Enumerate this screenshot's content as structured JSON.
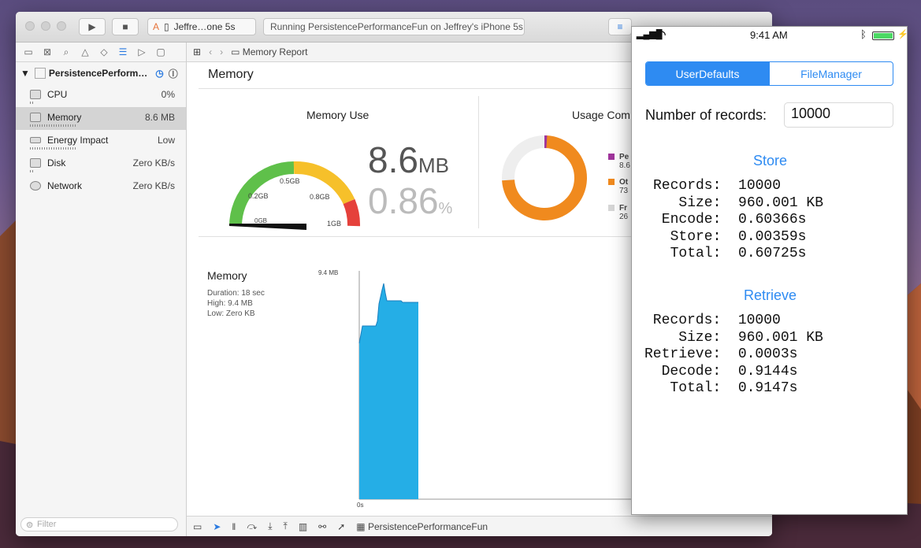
{
  "desktop": {
    "description": "macOS Sierra wallpaper"
  },
  "xcode": {
    "toolbar": {
      "scheme_target": "Jeffre…one 5s",
      "activity_status": "Running PersistencePerformanceFun on Jeffrey's iPhone 5s"
    },
    "navigator": {
      "project_name": "PersistencePerform…",
      "gauges": [
        {
          "label": "CPU",
          "value": "0%"
        },
        {
          "label": "Memory",
          "value": "8.6 MB"
        },
        {
          "label": "Energy Impact",
          "value": "Low"
        },
        {
          "label": "Disk",
          "value": "Zero KB/s"
        },
        {
          "label": "Network",
          "value": "Zero KB/s"
        }
      ],
      "filter_placeholder": "Filter"
    },
    "jumpbar": {
      "crumb": "Memory Report"
    },
    "report": {
      "title": "Memory",
      "memory_use": {
        "title": "Memory Use",
        "ticks": [
          "0GB",
          "0.2GB",
          "0.5GB",
          "0.8GB",
          "1GB"
        ],
        "value": "8.6",
        "value_unit": "MB",
        "percent": "0.86",
        "percent_unit": "%"
      },
      "usage_comparison": {
        "title": "Usage Com",
        "legend": [
          {
            "label": "Pe",
            "sub": "8.6",
            "color": "#a0359c"
          },
          {
            "label": "Ot",
            "sub": "73",
            "color": "#f08a1e"
          },
          {
            "label": "Fr",
            "sub": "26",
            "color": "#d6d6d6"
          }
        ]
      },
      "timeline": {
        "title": "Memory",
        "duration": "Duration: 18 sec",
        "high": "High: 9.4 MB",
        "low": "Low: Zero KB",
        "ymax_label": "9.4 MB",
        "x0_label": "0s"
      }
    },
    "debugbar": {
      "process": "PersistencePerformanceFun"
    }
  },
  "simulator": {
    "status": {
      "time": "9:41 AM"
    },
    "segments": {
      "left": "UserDefaults",
      "right": "FileManager"
    },
    "records_label": "Number of records:",
    "records_value": "10000",
    "store": {
      "title": "Store",
      "lines": "Records:  10000\n   Size:  960.001 KB\n Encode:  0.60366s\n  Store:  0.00359s\n  Total:  0.60725s"
    },
    "retrieve": {
      "title": "Retrieve",
      "lines": " Records:  10000\n    Size:  960.001 KB\nRetrieve:  0.0003s\n  Decode:  0.9144s\n   Total:  0.9147s"
    }
  }
}
